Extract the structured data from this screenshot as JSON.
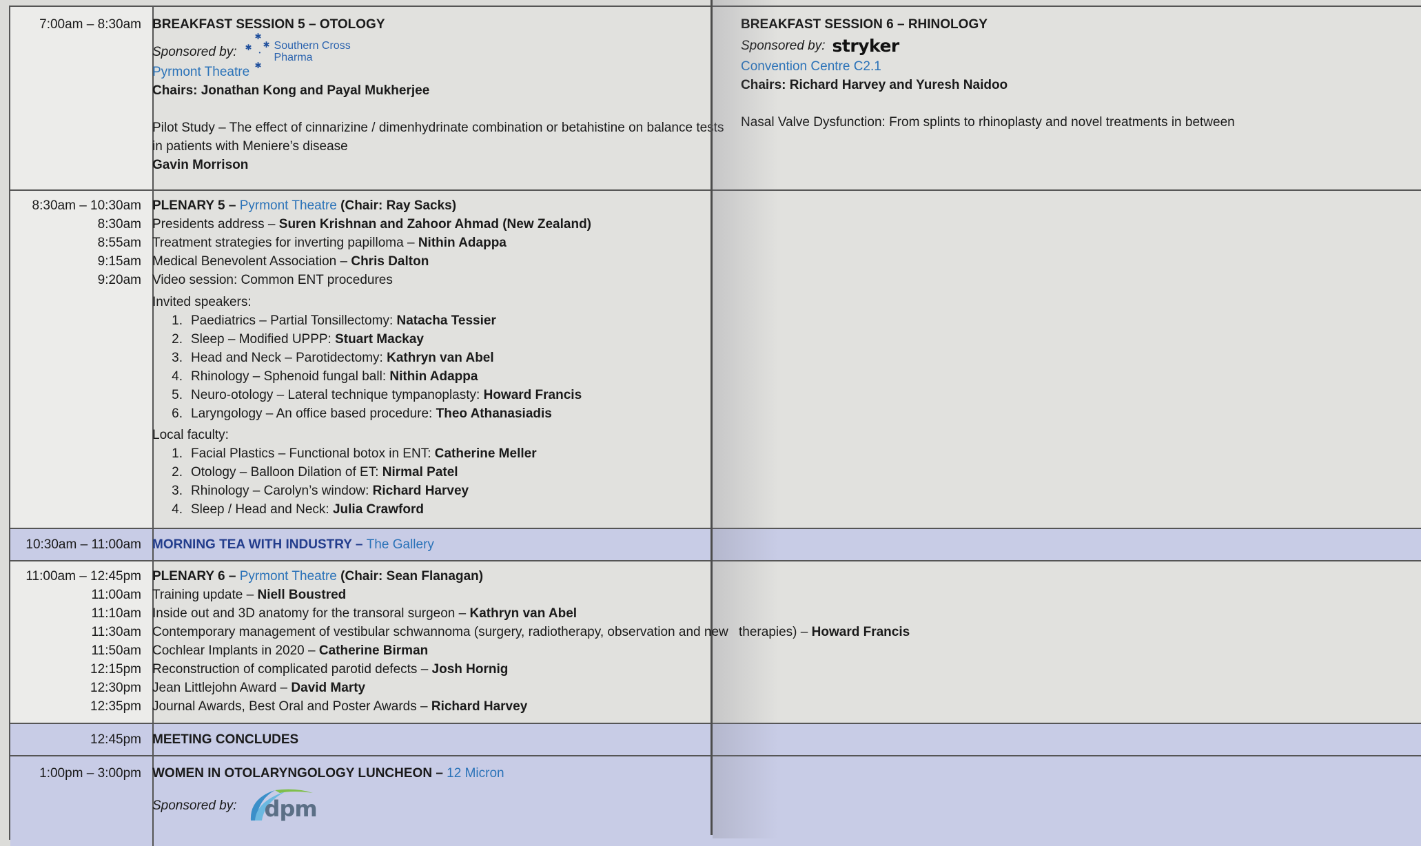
{
  "breakfast": {
    "time": "7:00am – 8:30am",
    "left": {
      "title": "BREAKFAST SESSION 5 – OTOLOGY",
      "sponsored_by": "Sponsored by:",
      "sponsor_logo_line1": "Southern Cross",
      "sponsor_logo_line2": "Pharma",
      "venue": "Pyrmont Theatre",
      "chairs": "Chairs: Jonathan Kong and Payal Mukherjee",
      "talk_line1": "Pilot Study – The effect of cinnarizine / dimenhydrinate combination or betahistine on balance tests",
      "talk_line2": "in patients with Meniere’s disease",
      "speaker": "Gavin Morrison"
    },
    "right": {
      "title": "BREAKFAST SESSION 6 – RHINOLOGY",
      "sponsored_by": "Sponsored by:",
      "sponsor_logo": "stryker",
      "venue": "Convention Centre C2.1",
      "chairs": "Chairs: Richard Harvey and Yuresh Naidoo",
      "talk": "Nasal Valve Dysfunction: From splints to rhinoplasty and novel treatments in between"
    }
  },
  "plenary5": {
    "time": "8:30am – 10:30am",
    "title_prefix": "PLENARY 5 – ",
    "venue": "Pyrmont Theatre",
    "chair": " (Chair: Ray Sacks)",
    "items": [
      {
        "time": "8:30am",
        "text": "Presidents address – ",
        "speaker": "Suren Krishnan and Zahoor Ahmad (New Zealand)"
      },
      {
        "time": "8:55am",
        "text": "Treatment strategies for inverting papilloma – ",
        "speaker": "Nithin Adappa"
      },
      {
        "time": "9:15am",
        "text": "Medical Benevolent Association – ",
        "speaker": "Chris Dalton"
      },
      {
        "time": "9:20am",
        "text": "Video session: Common ENT procedures",
        "speaker": ""
      }
    ],
    "invited_label": "Invited speakers:",
    "invited": [
      {
        "n": "1.",
        "text": "Paediatrics – Partial Tonsillectomy: ",
        "speaker": "Natacha Tessier"
      },
      {
        "n": "2.",
        "text": "Sleep – Modified UPPP: ",
        "speaker": "Stuart Mackay"
      },
      {
        "n": "3.",
        "text": "Head and Neck – Parotidectomy: ",
        "speaker": "Kathryn van Abel"
      },
      {
        "n": "4.",
        "text": "Rhinology – Sphenoid fungal ball: ",
        "speaker": "Nithin Adappa"
      },
      {
        "n": "5.",
        "text": "Neuro-otology – Lateral technique tympanoplasty: ",
        "speaker": "Howard Francis"
      },
      {
        "n": "6.",
        "text": "Laryngology – An office based procedure: ",
        "speaker": "Theo Athanasiadis"
      }
    ],
    "local_label": "Local faculty:",
    "local": [
      {
        "n": "1.",
        "text": "Facial Plastics – Functional botox in ENT: ",
        "speaker": "Catherine Meller"
      },
      {
        "n": "2.",
        "text": "Otology – Balloon Dilation of ET: ",
        "speaker": "Nirmal Patel"
      },
      {
        "n": "3.",
        "text": "Rhinology – Carolyn’s window: ",
        "speaker": "Richard Harvey"
      },
      {
        "n": "4.",
        "text": "Sleep / Head and Neck: ",
        "speaker": "Julia Crawford"
      }
    ]
  },
  "morning_tea": {
    "time": "10:30am – 11:00am",
    "title": "MORNING TEA WITH INDUSTRY – ",
    "venue": "The Gallery"
  },
  "plenary6": {
    "time": "11:00am – 12:45pm",
    "title_prefix": "PLENARY 6 – ",
    "venue": "Pyrmont Theatre",
    "chair": " (Chair: Sean Flanagan)",
    "items": [
      {
        "time": "11:00am",
        "text": "Training update – ",
        "speaker": "Niell Boustred"
      },
      {
        "time": "11:10am",
        "text": "Inside out and 3D anatomy for the transoral surgeon – ",
        "speaker": "Kathryn van Abel"
      },
      {
        "time": "11:30am",
        "text": "Contemporary management of vestibular schwannoma (surgery, radiotherapy, observation and new ",
        "text2": "therapies) – ",
        "speaker": "Howard Francis"
      },
      {
        "time": "11:50am",
        "text": "Cochlear Implants in 2020 – ",
        "speaker": "Catherine Birman"
      },
      {
        "time": "12:15pm",
        "text": "Reconstruction of complicated parotid defects – ",
        "speaker": "Josh Hornig"
      },
      {
        "time": "12:30pm",
        "text": "Jean Littlejohn Award – ",
        "speaker": "David Marty"
      },
      {
        "time": "12:35pm",
        "text": "Journal Awards, Best Oral and Poster Awards – ",
        "speaker": "Richard Harvey"
      }
    ]
  },
  "meeting_concludes": {
    "time": "12:45pm",
    "title": "MEETING CONCLUDES"
  },
  "luncheon": {
    "time": "1:00pm – 3:00pm",
    "title": "WOMEN IN OTOLARYNGOLOGY LUNCHEON – ",
    "venue": "12 Micron",
    "sponsored_by": "Sponsored by:",
    "sponsor_logo": "dpm"
  }
}
